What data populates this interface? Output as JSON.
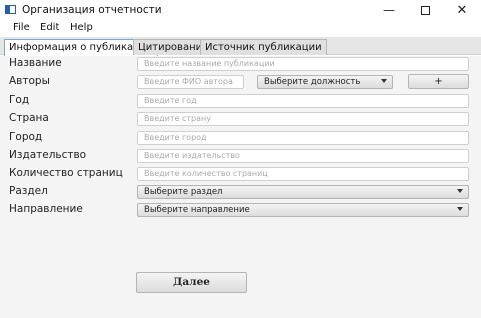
{
  "window": {
    "title": "Организация отчетности",
    "minimize": "—",
    "close": "✕"
  },
  "menu": [
    "File",
    "Edit",
    "Help"
  ],
  "tabs": [
    {
      "label": "Информация о публикации",
      "active": true
    },
    {
      "label": "Цитирование",
      "active": false
    },
    {
      "label": "Источник публикации",
      "active": false
    }
  ],
  "form": {
    "title": {
      "label": "Название",
      "placeholder": "Введите название публикации"
    },
    "authors": {
      "label": "Авторы",
      "placeholder": "Введите ФИО автора",
      "position_select": "Выберите должность",
      "add_label": "+"
    },
    "year": {
      "label": "Год",
      "placeholder": "Введите год"
    },
    "country": {
      "label": "Страна",
      "placeholder": "Введите страну"
    },
    "city": {
      "label": "Город",
      "placeholder": "Введите город"
    },
    "publisher": {
      "label": "Издательство",
      "placeholder": "Введите издательство"
    },
    "pages": {
      "label": "Количество страниц",
      "placeholder": "Введите количество страниц"
    },
    "section": {
      "label": "Раздел",
      "select": "Выберите раздел"
    },
    "direction": {
      "label": "Направление",
      "select": "Выберите направление"
    }
  },
  "next_label": "Далее"
}
